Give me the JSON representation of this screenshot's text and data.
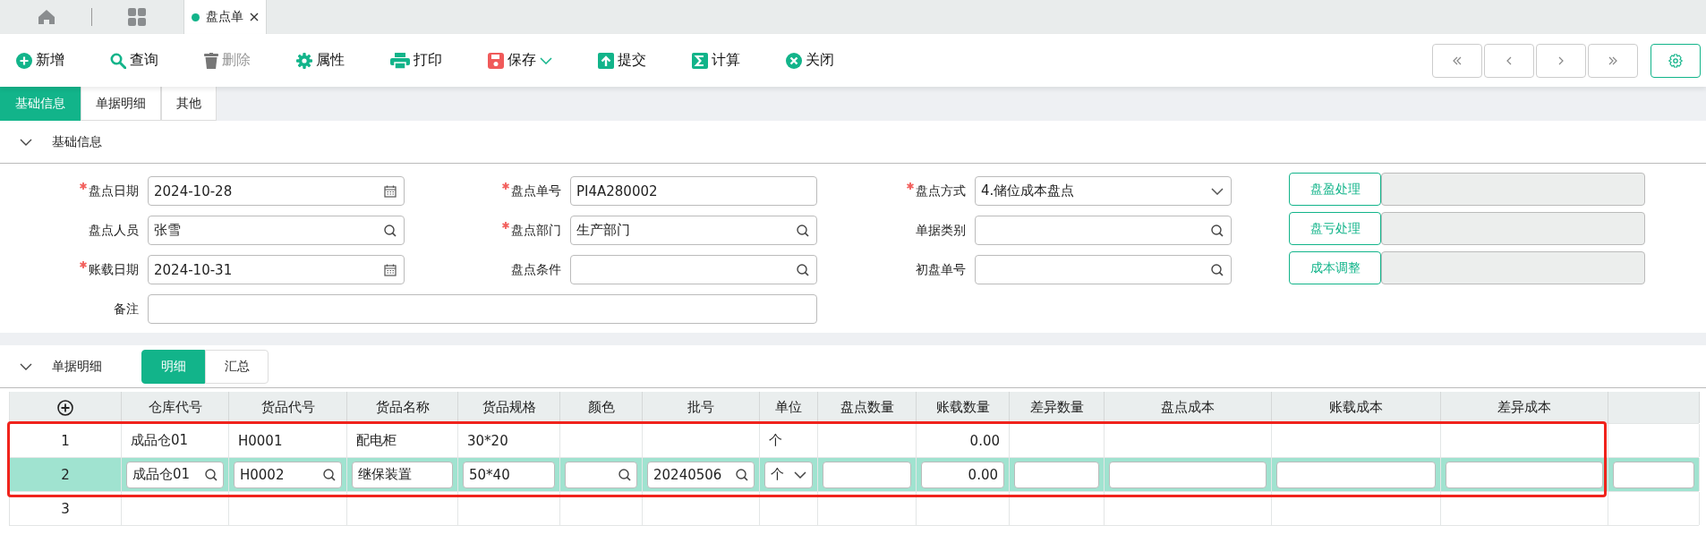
{
  "window_tabs": [
    {
      "kind": "home",
      "selected": false
    },
    {
      "kind": "apps",
      "selected": false
    },
    {
      "kind": "document",
      "label": "盘点单",
      "selected": true
    }
  ],
  "toolbar": [
    {
      "kind": "add",
      "label": "新增",
      "disabled": false
    },
    {
      "kind": "search",
      "label": "查询",
      "disabled": false
    },
    {
      "kind": "delete",
      "label": "删除",
      "disabled": true
    },
    {
      "kind": "gear",
      "label": "属性",
      "disabled": false
    },
    {
      "kind": "print",
      "label": "打印",
      "disabled": false
    },
    {
      "kind": "save",
      "label": "保存",
      "disabled": false,
      "dropdown": true
    },
    {
      "kind": "submit",
      "label": "提交",
      "disabled": false
    },
    {
      "kind": "sum",
      "label": "计算",
      "disabled": false
    },
    {
      "kind": "close",
      "label": "关闭",
      "disabled": false
    }
  ],
  "page_tabs": [
    {
      "label": "基础信息",
      "selected": true
    },
    {
      "label": "单据明细",
      "selected": false
    },
    {
      "label": "其他",
      "selected": false
    }
  ],
  "basic_section": {
    "title": "基础信息",
    "expanded": true,
    "rows": [
      {
        "fields": [
          {
            "label": "盘点日期",
            "required": true,
            "kind": "date",
            "value": "2024-10-28"
          },
          {
            "label": "盘点单号",
            "required": true,
            "kind": "text",
            "value": "PI4A280002"
          },
          {
            "label": "盘点方式",
            "required": true,
            "kind": "select",
            "value": "4.储位成本盘点"
          }
        ],
        "action": "盘盈处理"
      },
      {
        "fields": [
          {
            "label": "盘点人员",
            "required": false,
            "kind": "lookup",
            "value": "张雪"
          },
          {
            "label": "盘点部门",
            "required": true,
            "kind": "lookup",
            "value": "生产部门"
          },
          {
            "label": "单据类别",
            "required": false,
            "kind": "lookup"
          }
        ],
        "action": "盘亏处理"
      },
      {
        "fields": [
          {
            "label": "账载日期",
            "required": true,
            "kind": "date",
            "value": "2024-10-31"
          },
          {
            "label": "盘点条件",
            "required": false,
            "kind": "lookup"
          },
          {
            "label": "初盘单号",
            "required": false,
            "kind": "lookup"
          }
        ],
        "action": "成本调整"
      },
      {
        "fields": [
          {
            "label": "备注",
            "required": false,
            "kind": "note"
          }
        ]
      }
    ]
  },
  "detail_section": {
    "title": "单据明细",
    "expanded": true,
    "views": [
      {
        "label": "明细",
        "selected": true
      },
      {
        "label": "汇总",
        "selected": false
      }
    ],
    "table": {
      "columns": [
        {
          "label": "仓库代号",
          "kind": "lookup"
        },
        {
          "label": "货品代号",
          "kind": "lookup"
        },
        {
          "label": "货品名称",
          "kind": "text"
        },
        {
          "label": "货品规格",
          "kind": "text"
        },
        {
          "label": "颜色",
          "kind": "lookup"
        },
        {
          "label": "批号",
          "kind": "lookup"
        },
        {
          "label": "单位",
          "kind": "select"
        },
        {
          "label": "盘点数量",
          "kind": "number"
        },
        {
          "label": "账载数量",
          "kind": "number"
        },
        {
          "label": "差异数量",
          "kind": "number"
        },
        {
          "label": "盘点成本",
          "kind": "number"
        },
        {
          "label": "账载成本",
          "kind": "number"
        },
        {
          "label": "差异成本",
          "kind": "number"
        },
        {
          "kind": "number"
        }
      ],
      "rows": [
        {
          "number": "1",
          "selected": false,
          "cells": [
            {
              "value": "成品仓01"
            },
            {
              "value": "H0001"
            },
            {
              "value": "配电柜"
            },
            {
              "value": "30*20"
            },
            {},
            {},
            {
              "value": "个"
            },
            {},
            {
              "value": "0.00"
            },
            {},
            {},
            {},
            {},
            {}
          ]
        },
        {
          "number": "2",
          "selected": true,
          "cells": [
            {
              "value": "成品仓01"
            },
            {
              "value": "H0002"
            },
            {
              "value": "继保装置"
            },
            {
              "value": "50*40"
            },
            {},
            {
              "value": "20240506"
            },
            {
              "value": "个"
            },
            {},
            {
              "value": "0.00"
            },
            {},
            {},
            {},
            {},
            {}
          ]
        },
        {
          "number": "3",
          "selected": false
        }
      ]
    }
  }
}
